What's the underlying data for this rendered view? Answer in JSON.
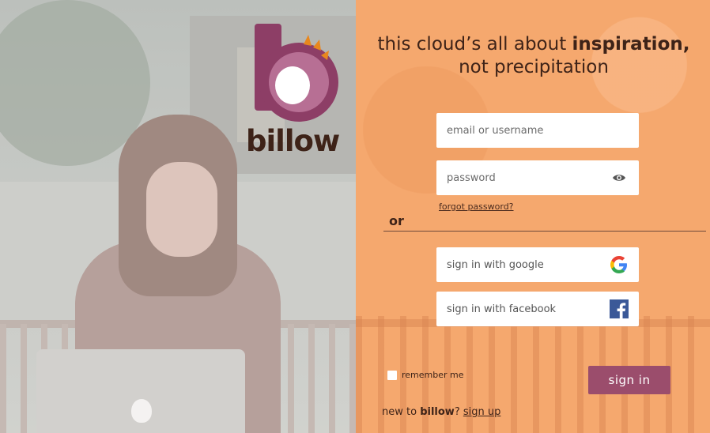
{
  "brand": {
    "name": "billow"
  },
  "heading": {
    "line1_pre": "this cloud’s all about ",
    "line1_bold": "inspiration,",
    "line2": "not precipitation"
  },
  "form": {
    "username_placeholder": "email or username",
    "password_placeholder": "password",
    "password_icon": "eye-icon",
    "forgot_label": "forgot password?",
    "or_label": "or",
    "google_label": "sign in with google",
    "google_icon": "google-icon",
    "facebook_label": "sign in with facebook",
    "facebook_icon": "facebook-icon",
    "remember_label": "remember me",
    "remember_checked": false,
    "signin_label": "sign in"
  },
  "footer": {
    "new_to": "new to ",
    "brand": "billow",
    "question": "? ",
    "signup_label": "sign up"
  },
  "colors": {
    "orange_panel": "#f5a86e",
    "brand_purple": "#9b4d6c",
    "text_brown": "#3e2318",
    "facebook_blue": "#3b5998"
  }
}
